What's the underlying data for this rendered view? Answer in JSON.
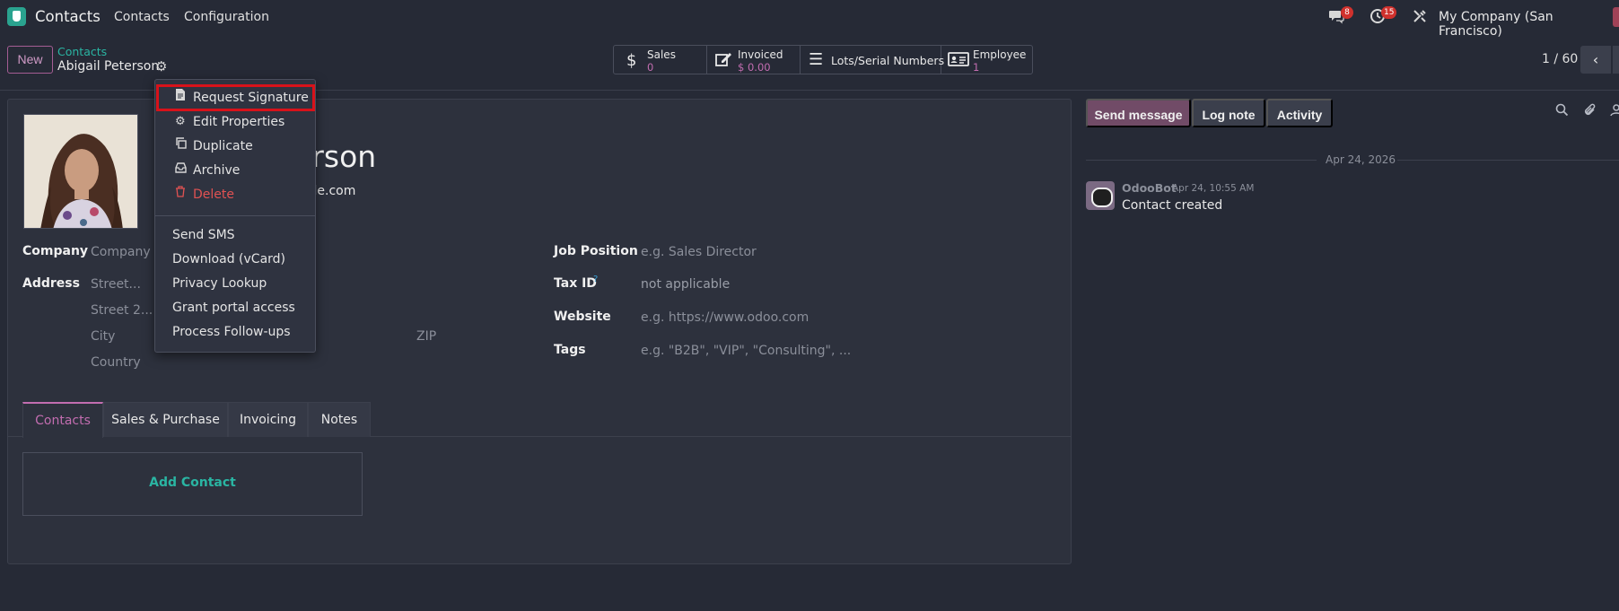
{
  "navbar": {
    "app_name": "Contacts",
    "menu": [
      "Contacts",
      "Configuration"
    ],
    "messages_badge": "8",
    "activities_badge": "15",
    "company": "My Company (San Francisco)"
  },
  "control_panel": {
    "new_label": "New",
    "breadcrumb": "Contacts",
    "record_name": "Abigail Peterson",
    "smart_buttons": {
      "sales_title": "Sales",
      "sales_value": "0",
      "invoiced_title": "Invoiced",
      "invoiced_value": "$ 0.00",
      "lots_title": "Lots/Serial Numbers",
      "employee_title": "Employee",
      "employee_value": "1"
    },
    "pager": "1 / 60"
  },
  "form": {
    "name_partial": "erson",
    "email_partial": "mple.com",
    "company_label": "Company",
    "company_placeholder": "Company N",
    "address_label": "Address",
    "street_ph": "Street...",
    "street2_ph": "Street 2...",
    "city_ph": "City",
    "zip_ph": "ZIP",
    "country_ph": "Country",
    "job_label": "Job Position",
    "job_ph": "e.g. Sales Director",
    "tax_label": "Tax ID",
    "tax_help": "?",
    "tax_value": "not applicable",
    "website_label": "Website",
    "website_ph": "e.g. https://www.odoo.com",
    "tags_label": "Tags",
    "tags_ph": "e.g. \"B2B\", \"VIP\", \"Consulting\", ...",
    "tabs": [
      "Contacts",
      "Sales & Purchase",
      "Invoicing",
      "Notes"
    ],
    "add_contact": "Add Contact"
  },
  "chatter": {
    "send_message": "Send message",
    "log_note": "Log note",
    "activity": "Activity",
    "date": "Apr 24, 2026",
    "author": "OdooBot",
    "time": "Apr 24, 10:55 AM",
    "message": "Contact created"
  },
  "dropdown": {
    "items": [
      {
        "label": "Request Signature",
        "icon": "file-signature-icon"
      },
      {
        "label": "Edit Properties",
        "icon": "cogs-icon"
      },
      {
        "label": "Duplicate",
        "icon": "copy-icon"
      },
      {
        "label": "Archive",
        "icon": "archive-icon"
      },
      {
        "label": "Delete",
        "icon": "trash-icon"
      },
      {
        "label": "Send SMS"
      },
      {
        "label": "Download (vCard)"
      },
      {
        "label": "Privacy Lookup"
      },
      {
        "label": "Grant portal access"
      },
      {
        "label": "Process Follow-ups"
      }
    ]
  },
  "colors": {
    "accent": "#714b67",
    "teal": "#2ab5a3",
    "danger": "#e05252",
    "highlight": "#d8121a"
  }
}
